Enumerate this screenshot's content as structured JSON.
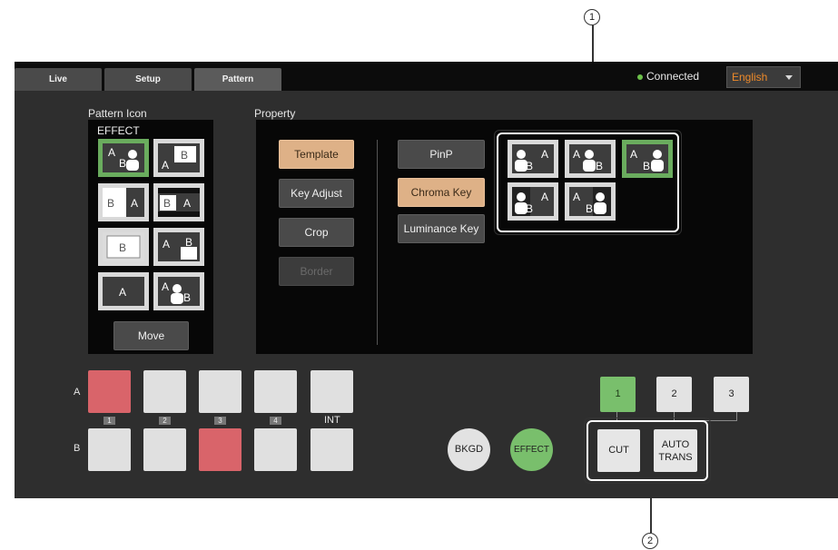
{
  "callouts": [
    "1",
    "2"
  ],
  "tabs": [
    {
      "label": "Live",
      "active": false
    },
    {
      "label": "Setup",
      "active": false
    },
    {
      "label": "Pattern",
      "active": true
    }
  ],
  "status": {
    "text": "Connected",
    "color": "#6cc04a"
  },
  "language": {
    "selected": "English"
  },
  "pattern_icon": {
    "label": "Pattern Icon",
    "category": "EFFECT",
    "icons": [
      {
        "name": "effect-a-b-person",
        "selected": true
      },
      {
        "name": "effect-a-b-window",
        "selected": false
      },
      {
        "name": "effect-b-split-a",
        "selected": false
      },
      {
        "name": "effect-b-a-bar",
        "selected": false
      },
      {
        "name": "effect-b-box",
        "selected": false
      },
      {
        "name": "effect-a-b-corner",
        "selected": false
      },
      {
        "name": "effect-a-label",
        "selected": false
      },
      {
        "name": "effect-a-b-person-2",
        "selected": false
      }
    ],
    "move_label": "Move"
  },
  "property": {
    "label": "Property",
    "left_buttons": [
      {
        "label": "Template",
        "state": "active"
      },
      {
        "label": "Key Adjust",
        "state": "normal"
      },
      {
        "label": "Crop",
        "state": "normal"
      },
      {
        "label": "Border",
        "state": "disabled"
      }
    ],
    "right_buttons": [
      {
        "label": "PinP",
        "state": "normal"
      },
      {
        "label": "Chroma Key",
        "state": "active"
      },
      {
        "label": "Luminance Key",
        "state": "normal"
      }
    ],
    "templates": [
      {
        "name": "tpl-person-b-a",
        "selected": false
      },
      {
        "name": "tpl-a-person-b",
        "selected": false
      },
      {
        "name": "tpl-a-b-person",
        "selected": true
      },
      {
        "name": "tpl-person-b-a-2",
        "selected": false
      },
      {
        "name": "tpl-a-b-person-2",
        "selected": false
      }
    ]
  },
  "crosspoint": {
    "row_a": "A",
    "row_b": "B",
    "numbers": [
      "1",
      "2",
      "3",
      "4"
    ],
    "int_label": "INT",
    "a_selected": 1,
    "b_selected": 3
  },
  "transition": {
    "bkgd": "BKGD",
    "effect": "EFFECT",
    "cut": "CUT",
    "auto_trans": "AUTO TRANS",
    "presets": [
      "1",
      "2",
      "3"
    ],
    "preset_selected": 1
  },
  "colors": {
    "accent_orange": "#deb187",
    "selected_green": "#79bf6c",
    "selected_red": "#d9646a"
  }
}
